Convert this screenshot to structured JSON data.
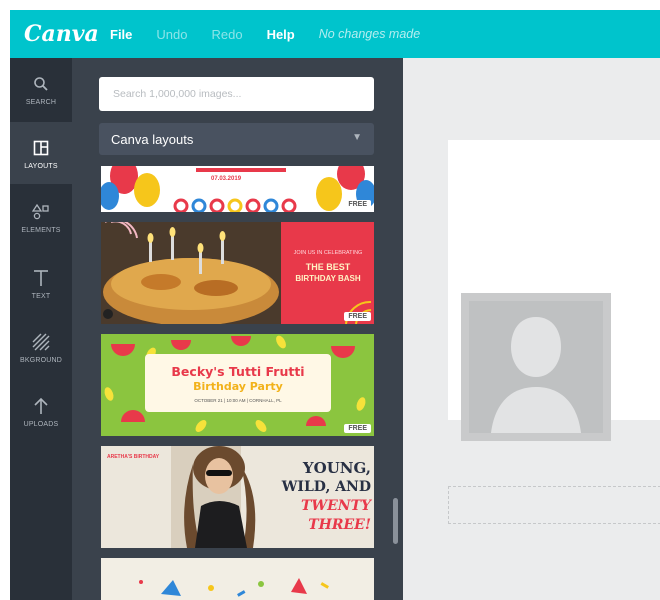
{
  "app": {
    "logo": "Canva"
  },
  "menu": {
    "file": "File",
    "undo": "Undo",
    "redo": "Redo",
    "help": "Help",
    "status": "No changes made"
  },
  "sidebar": {
    "items": [
      {
        "label": "SEARCH",
        "icon": "search-icon"
      },
      {
        "label": "LAYOUTS",
        "icon": "layouts-icon",
        "active": true
      },
      {
        "label": "ELEMENTS",
        "icon": "elements-icon"
      },
      {
        "label": "TEXT",
        "icon": "text-icon"
      },
      {
        "label": "BKGROUND",
        "icon": "background-icon"
      },
      {
        "label": "UPLOADS",
        "icon": "upload-icon"
      }
    ]
  },
  "panel": {
    "search_placeholder": "Search 1,000,000 images...",
    "dropdown_value": "Canva layouts",
    "templates": [
      {
        "id": "t1",
        "title_line": "",
        "date": "07.03.2019",
        "badge": "FREE"
      },
      {
        "id": "t2",
        "line1": "JOIN US IN CELEBRATING",
        "line2": "THE BEST",
        "line3": "BIRTHDAY BASH",
        "badge": "FREE"
      },
      {
        "id": "t3",
        "line1": "Becky's Tutti Frutti",
        "line2": "Birthday Party",
        "line3": "OCTOBER 21 | 10:00 AM | CORNHALL, PL",
        "badge": "FREE"
      },
      {
        "id": "t4",
        "line1": "YOUNG,",
        "line2": "WILD, AND",
        "line3": "TWENTY",
        "line4": "THREE!",
        "small": "ARETHA'S BIRTHDAY"
      },
      {
        "id": "t5"
      }
    ]
  },
  "colors": {
    "topbar": "#00c4cc",
    "rail": "#293039",
    "panel": "#3a424c",
    "accent_red": "#e8394a",
    "accent_green": "#8bc53f"
  }
}
